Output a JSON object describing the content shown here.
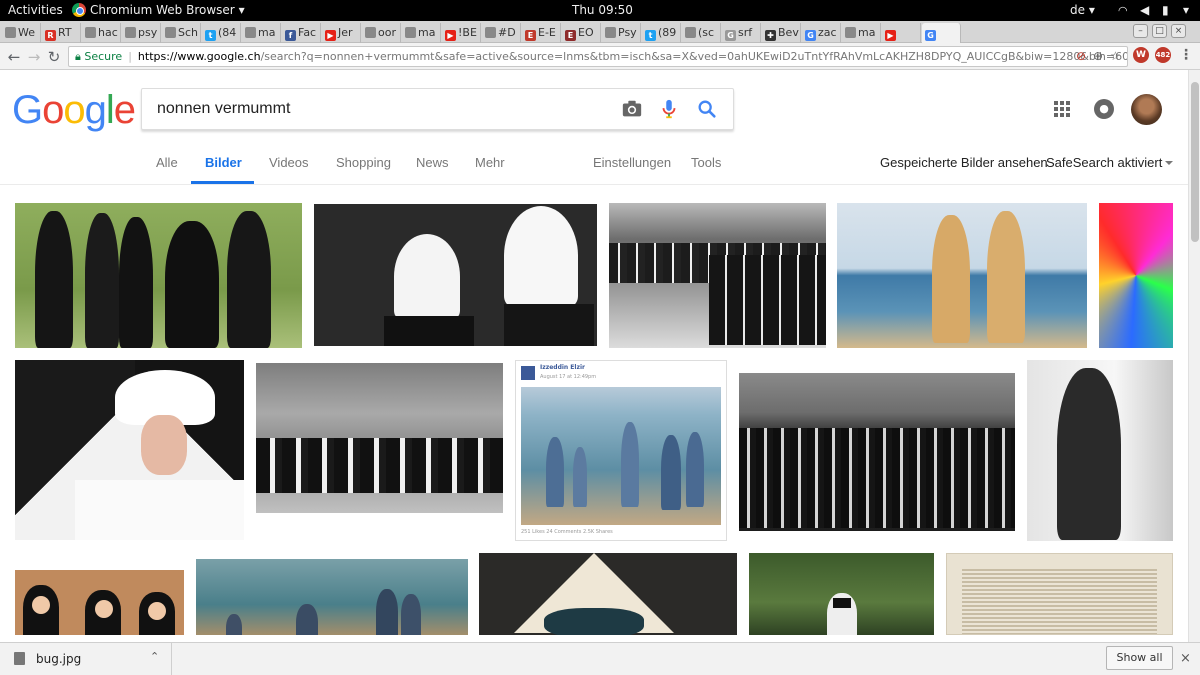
{
  "system": {
    "activities": "Activities",
    "app_menu": "Chromium Web Browser",
    "clock": "Thu 09:50",
    "keyboard_layout": "de"
  },
  "browser": {
    "tabs": [
      {
        "label": "We",
        "favicon": "document",
        "color": "#888888"
      },
      {
        "label": "RT",
        "favicon": "rt",
        "color": "#d93025"
      },
      {
        "label": "hac",
        "favicon": "document",
        "color": "#888888"
      },
      {
        "label": "psy",
        "favicon": "document",
        "color": "#888888"
      },
      {
        "label": "Sch",
        "favicon": "document",
        "color": "#888888"
      },
      {
        "label": "(84",
        "favicon": "twitter",
        "color": "#1da1f2"
      },
      {
        "label": "ma",
        "favicon": "document",
        "color": "#888888"
      },
      {
        "label": "Fac",
        "favicon": "facebook",
        "color": "#3b5998"
      },
      {
        "label": "Jer",
        "favicon": "youtube",
        "color": "#e62117"
      },
      {
        "label": "oor",
        "favicon": "document",
        "color": "#888888"
      },
      {
        "label": "ma",
        "favicon": "document",
        "color": "#888888"
      },
      {
        "label": "!BE",
        "favicon": "youtube",
        "color": "#e62117"
      },
      {
        "label": "#D",
        "favicon": "document",
        "color": "#888888"
      },
      {
        "label": "E-E",
        "favicon": "ee",
        "color": "#c0392b"
      },
      {
        "label": "EO",
        "favicon": "eo",
        "color": "#8e2b2b"
      },
      {
        "label": "Psy",
        "favicon": "document",
        "color": "#888888"
      },
      {
        "label": "(89",
        "favicon": "twitter",
        "color": "#1da1f2"
      },
      {
        "label": "(sc",
        "favicon": "document",
        "color": "#888888"
      },
      {
        "label": "srf",
        "favicon": "google",
        "color": "#999999"
      },
      {
        "label": "Bev",
        "favicon": "puzzle",
        "color": "#333333"
      },
      {
        "label": "zac",
        "favicon": "google",
        "color": "#4285f4"
      },
      {
        "label": "ma",
        "favicon": "document",
        "color": "#888888"
      },
      {
        "label": "",
        "favicon": "youtube",
        "color": "#e62117"
      },
      {
        "label": "",
        "favicon": "google",
        "color": "#4285f4"
      }
    ],
    "secure_label": "Secure",
    "url_host": "https://www.google.ch",
    "url_path": "/search?q=nonnen+vermummt&safe=active&source=lnms&tbm=isch&sa=X&ved=0ahUKEwiD2uTntYfRAhVmLcAKHZH8DPYQ_AUICCgB&biw=1280&bih=603",
    "extension_badge": "482"
  },
  "google": {
    "logo_letters": [
      "G",
      "o",
      "o",
      "g",
      "l",
      "e"
    ],
    "query": "nonnen vermummt",
    "tabs": [
      {
        "label": "Alle",
        "active": false
      },
      {
        "label": "Bilder",
        "active": true
      },
      {
        "label": "Videos",
        "active": false
      },
      {
        "label": "Shopping",
        "active": false
      },
      {
        "label": "News",
        "active": false
      },
      {
        "label": "Mehr",
        "active": false
      },
      {
        "label": "Einstellungen",
        "active": false
      },
      {
        "label": "Tools",
        "active": false
      }
    ],
    "saved_images": "Gespeicherte Bilder ansehen",
    "safesearch": "SafeSearch aktiviert"
  },
  "results": {
    "images": [
      {
        "description": "nuns in black habits in a garden"
      },
      {
        "description": "two nuns with white veils from above"
      },
      {
        "description": "procession of nuns black and white photo"
      },
      {
        "description": "two nuns walking on the beach"
      },
      {
        "description": "colorful abstract image"
      },
      {
        "description": "nun praying with rosary"
      },
      {
        "description": "row of nuns in old photograph"
      },
      {
        "description": "nuns wading at the beach"
      },
      {
        "description": "group photo of priests and nuns"
      },
      {
        "description": "veiled woman in hallway"
      },
      {
        "description": "nuns smiling"
      },
      {
        "description": "nuns at the seaside"
      },
      {
        "description": "person wearing conical hat"
      },
      {
        "description": "veiled person in forest"
      },
      {
        "description": "old engraving"
      }
    ],
    "social_post": {
      "author": "Izzeddin Elzir",
      "date": "August 17 at 12:49pm",
      "stats": "251 Likes  24 Comments  2.5K Shares"
    }
  },
  "downloads": {
    "file_name": "bug.jpg",
    "show_all": "Show all"
  }
}
